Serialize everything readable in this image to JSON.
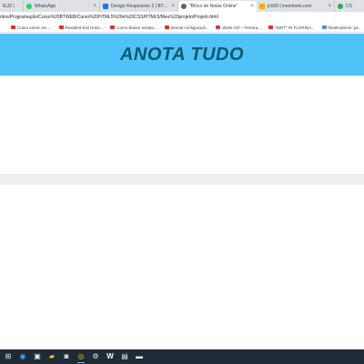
{
  "browser": {
    "tabs": [
      {
        "title": "EUZ |",
        "favicon_color": "#3c4043",
        "active": false
      },
      {
        "title": "WhatsApp",
        "favicon_color": "#25d366",
        "active": false
      },
      {
        "title": "Design Responsivo 2 | BTWeb",
        "favicon_color": "#1a73e8",
        "active": false
      },
      {
        "title": "\"Bloco de Notas Online\"",
        "favicon_color": "#5f6368",
        "active": true
      },
      {
        "title": "jch59 | invertexto.com",
        "favicon_color": "#f9ab00",
        "active": false
      },
      {
        "title": "CS",
        "favicon_color": "#34a853",
        "active": false
      }
    ],
    "tab_close_glyph": "×",
    "address_url": "ntos/Programação/Curso%20BTWEB/Curso%20HTML5%20e%20CSS/HTML5/Meu%20projeto/Projeto.html",
    "bookmarks": [
      {
        "label": "Como entrar em ...",
        "icon": "youtube-icon"
      },
      {
        "label": "Resident Evil Untol...",
        "icon": "youtube-icon"
      },
      {
        "label": "Como Baixar Instala...",
        "icon": "youtube-icon"
      },
      {
        "label": "tutorial configuraçã...",
        "icon": "youtube-icon"
      },
      {
        "label": "WoW Girl – Ferrara...",
        "icon": "instagram-icon"
      },
      {
        "label": "\"DIRT\" IN FLORIDA...",
        "icon": "youtube-icon"
      },
      {
        "label": "RealmsDeck: pa",
        "icon": "bookmark-icon"
      }
    ]
  },
  "page": {
    "title": "ANOTA TUDO",
    "header_color": "#4fc3f7",
    "title_color": "#0b5a73"
  },
  "taskbar": {
    "icons": [
      {
        "name": "start-icon",
        "glyph": "⊞"
      },
      {
        "name": "edge-icon",
        "glyph": "◉"
      },
      {
        "name": "windows-store-icon",
        "glyph": "▣"
      },
      {
        "name": "file-explorer-icon",
        "glyph": "▰"
      },
      {
        "name": "shopping-bag-icon",
        "glyph": "◙"
      },
      {
        "name": "chrome-icon",
        "glyph": "◎"
      },
      {
        "name": "steam-icon",
        "glyph": "⚙"
      },
      {
        "name": "word-icon",
        "glyph": "W"
      },
      {
        "name": "media-icon",
        "glyph": "▤"
      },
      {
        "name": "terminal-icon",
        "glyph": "▬"
      }
    ]
  }
}
